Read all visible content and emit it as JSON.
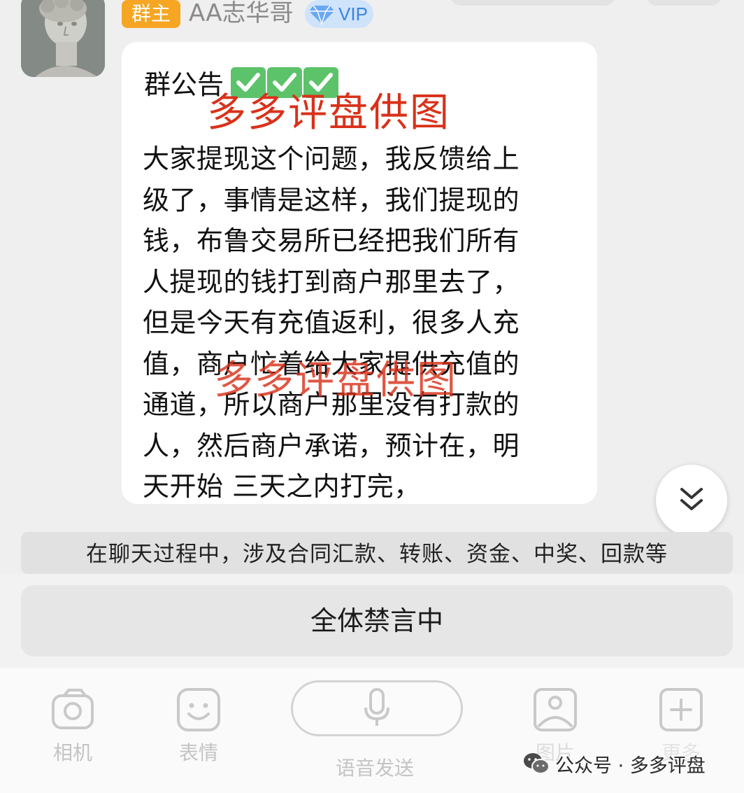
{
  "chat": {
    "sender": {
      "role_badge": "群主",
      "name": "AA志华哥",
      "vip_label": "VIP"
    },
    "message": {
      "title": "群公告",
      "title_emoji_count": 3,
      "body": "大家提现这个问题，我反馈给上\n级了，事情是这样，我们提现的\n钱，布鲁交易所已经把我们所有\n人提现的钱打到商户那里去了，\n但是今天有充值返利，很多人充\n值，商户忙着给大家提供充值的\n通道，所以商户那里没有打款的\n人，然后商户承诺，预计在，明\n天开始 三天之内打完，"
    },
    "watermarks": [
      "多多评盘供图",
      "多多评盘供图"
    ],
    "warning_notice": "在聊天过程中，涉及合同汇款、转账、资金、中奖、回款等",
    "mute_status": "全体禁言中"
  },
  "toolbar": {
    "camera_label": "相机",
    "emoji_label": "表情",
    "voice_label": "语音发送",
    "album_label": "图片",
    "more_label": "更多"
  },
  "footer_watermark": {
    "text": "公众号 · 多多评盘"
  },
  "colors": {
    "owner_badge": "#f6a623",
    "vip_blue": "#3b82e8",
    "watermark_red": "#d9311a",
    "check_green": "#5cc36a"
  },
  "icons": [
    "avatar-statue",
    "vip-diamond-icon",
    "check-mark-icon",
    "chevron-double-down-icon",
    "camera-icon",
    "smile-icon",
    "microphone-icon",
    "image-icon",
    "plus-icon",
    "wechat-icon"
  ]
}
